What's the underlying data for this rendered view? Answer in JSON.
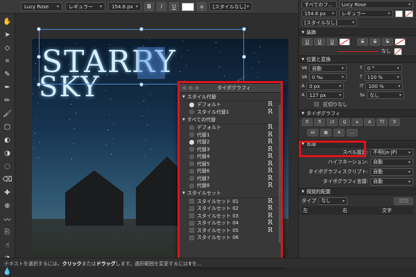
{
  "toolbar_top": {
    "font_family": "Lucy Rose",
    "font_style": "レギュラー",
    "font_size": "154.6 px",
    "bold": "B",
    "italic": "I",
    "underline": "U",
    "paragraph_style": "[スタイルなし]"
  },
  "left_tools": [
    "hand-icon",
    "move-icon",
    "node-icon",
    "crop-icon",
    "paint-icon",
    "pen-icon",
    "pencil-icon",
    "brush-icon",
    "shape-icon",
    "fill-icon",
    "gradient-icon",
    "transparency-icon",
    "eraser-icon",
    "color-picker-icon",
    "zoom-icon",
    "vector-brush-icon",
    "clone-icon",
    "smudge-icon",
    "dodge-icon",
    "blur-icon",
    "sponge-icon",
    "triangle-icon",
    "circle-icon",
    "text-icon"
  ],
  "document": {
    "title_line1": "STARRY",
    "title_line2": "SKY"
  },
  "typography_panel": {
    "title": "タイポグラフィ",
    "stylistic_alternates": {
      "header": "スタイル代替",
      "items": [
        {
          "label": "デフォルト",
          "selected": true,
          "glyph": "R"
        },
        {
          "label": "スタイル代替1",
          "selected": false,
          "glyph": "R"
        }
      ]
    },
    "all_alternates": {
      "header": "すべての代替",
      "items": [
        {
          "label": "デフォルト",
          "selected": false,
          "glyph": "R"
        },
        {
          "label": "代替1",
          "selected": false,
          "glyph": "R"
        },
        {
          "label": "代替2",
          "selected": true,
          "glyph": "R"
        },
        {
          "label": "代替3",
          "selected": false,
          "glyph": "R"
        },
        {
          "label": "代替4",
          "selected": false,
          "glyph": "R"
        },
        {
          "label": "代替5",
          "selected": false,
          "glyph": "R"
        },
        {
          "label": "代替6",
          "selected": false,
          "glyph": "R"
        },
        {
          "label": "代替7",
          "selected": false,
          "glyph": "R"
        },
        {
          "label": "代替8",
          "selected": false,
          "glyph": "R"
        }
      ]
    },
    "style_sets": {
      "header": "スタイルセット",
      "items": [
        {
          "label": "スタイルセット 01",
          "glyph": "R"
        },
        {
          "label": "スタイルセット 02",
          "glyph": "R"
        },
        {
          "label": "スタイルセット 03",
          "glyph": "R"
        },
        {
          "label": "スタイルセット 04",
          "glyph": "R"
        },
        {
          "label": "スタイルセット 05",
          "glyph": "R"
        },
        {
          "label": "スタイルセット 06",
          "glyph": ""
        }
      ]
    }
  },
  "right_panel": {
    "font_scope": "すべてのフ...",
    "font_family": "Lucy Rose",
    "font_size": "154.6 px",
    "font_style": "レギュラー",
    "paragraph_style": "[スタイルなし]",
    "decoration": {
      "header": "装飾",
      "none_label": "なし"
    },
    "position_transform": {
      "header": "位置と変換",
      "kerning": "自動",
      "tracking": "0 ‰",
      "baseline": "0 px",
      "leading": "127 px",
      "shear": "0 °",
      "h_scale": "110 %",
      "v_scale": "100 %",
      "case": "なし",
      "no_break": "区切りなし"
    },
    "typography": {
      "header": "タイポグラフィ",
      "tt_label": "TT",
      "tr_label": "Tr",
      "more_label": "..."
    },
    "language": {
      "header": "言語",
      "spell_label": "スペル設定:",
      "spell_value": "不明(ja-JP)",
      "hyphen_label": "ハイフネーション:",
      "hyphen_value": "自動",
      "script_label": "タイポグラフィスクリプト:",
      "script_value": "自動",
      "typo_lang_label": "タイポグラフィ言語:",
      "typo_lang_value": "自動"
    },
    "visual_alignment": {
      "header": "視覚的配置",
      "type_label": "タイプ",
      "type_value": "なし",
      "add_button": "追加",
      "col_left": "左",
      "col_right": "右",
      "col_char": "文字"
    }
  },
  "statusbar": {
    "text_a": "テキストを選択するには、",
    "bold_a": "クリック",
    "text_b": "または",
    "bold_b": "ドラッグ",
    "text_c": "します。選択範囲を変更するには",
    "bold_c": "⇧",
    "text_d": "を..."
  },
  "colors": {
    "highlight": "#e0141c",
    "selection": "#4a8cd0"
  }
}
